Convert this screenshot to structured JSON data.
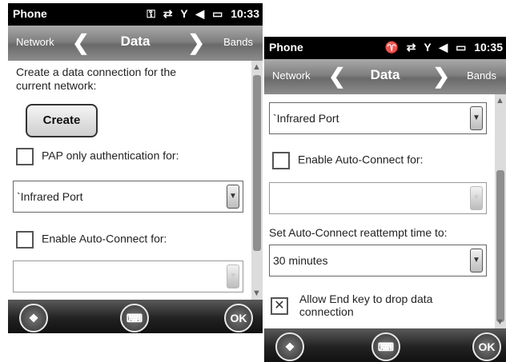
{
  "left": {
    "status": {
      "app": "Phone",
      "icons": [
        "⚿",
        "⇄",
        "Y",
        "◀",
        "▭"
      ],
      "time": "10:33"
    },
    "nav": {
      "prev": "Network",
      "title": "Data",
      "next": "Bands"
    },
    "line1": "Create a data connection for the",
    "line2": "current network:",
    "create": "Create",
    "pap": "PAP only authentication for:",
    "dropdown1": "`Infrared Port",
    "autoconnect": "Enable Auto-Connect for:",
    "ok": "OK"
  },
  "right": {
    "status": {
      "app": "Phone",
      "icons": [
        "♈",
        "⇄",
        "Y",
        "◀",
        "▭"
      ],
      "time": "10:35"
    },
    "nav": {
      "prev": "Network",
      "title": "Data",
      "next": "Bands"
    },
    "dropdown1": "`Infrared Port",
    "autoconnect": "Enable Auto-Connect for:",
    "reattempt": "Set Auto-Connect reattempt time to:",
    "time": "30 minutes",
    "endkey1": "Allow End key to drop data",
    "endkey2": "connection",
    "ok": "OK"
  }
}
